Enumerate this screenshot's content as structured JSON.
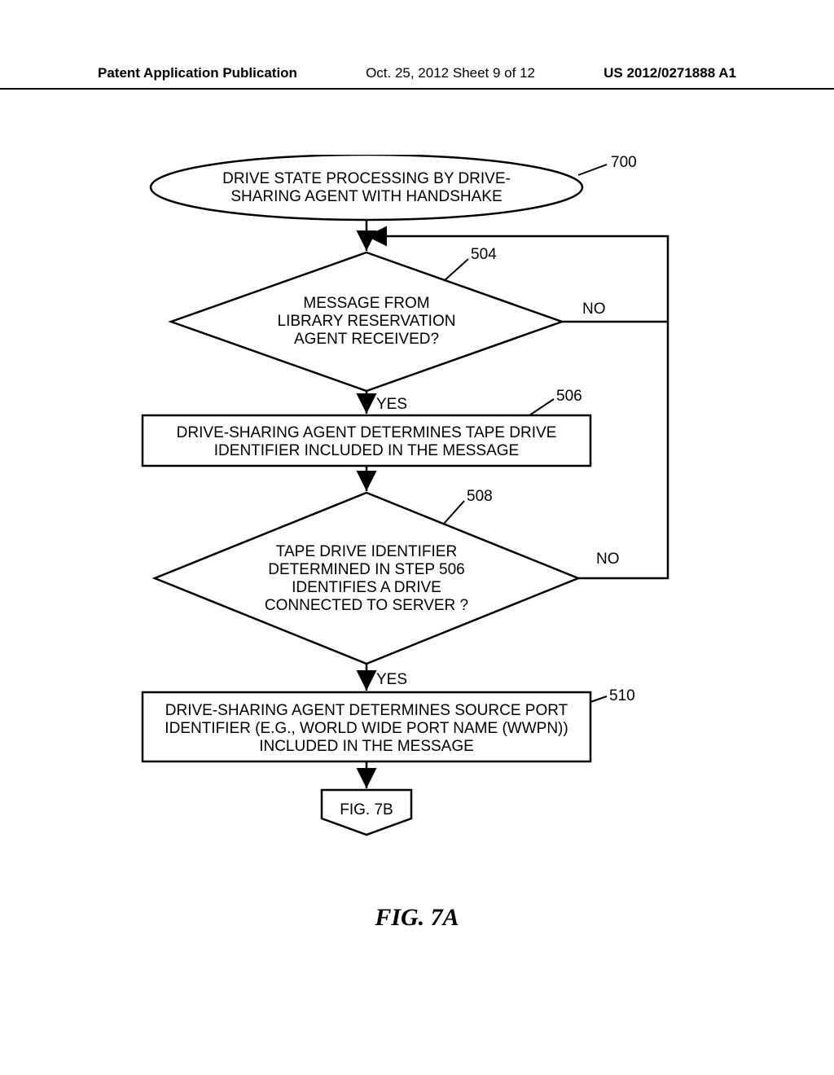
{
  "header": {
    "left": "Patent Application Publication",
    "center": "Oct. 25, 2012  Sheet 9 of 12",
    "right": "US 2012/0271888 A1"
  },
  "flowchart": {
    "terminal": {
      "line1": "DRIVE STATE PROCESSING BY DRIVE-",
      "line2": "SHARING AGENT WITH HANDSHAKE",
      "ref": "700"
    },
    "decision1": {
      "line1": "MESSAGE FROM",
      "line2": "LIBRARY RESERVATION",
      "line3": "AGENT RECEIVED?",
      "ref": "504",
      "yes": "YES",
      "no": "NO"
    },
    "process1": {
      "line1": "DRIVE-SHARING AGENT DETERMINES TAPE DRIVE",
      "line2": "IDENTIFIER INCLUDED IN THE MESSAGE",
      "ref": "506"
    },
    "decision2": {
      "line1": "TAPE DRIVE IDENTIFIER",
      "line2": "DETERMINED IN STEP 506",
      "line3": "IDENTIFIES A DRIVE",
      "line4": "CONNECTED TO SERVER ?",
      "ref": "508",
      "yes": "YES",
      "no": "NO"
    },
    "process2": {
      "line1": "DRIVE-SHARING AGENT DETERMINES SOURCE PORT",
      "line2": "IDENTIFIER (E.G., WORLD WIDE PORT NAME (WWPN))",
      "line3": "INCLUDED IN THE MESSAGE",
      "ref": "510"
    },
    "connector": {
      "text": "FIG. 7B"
    }
  },
  "caption": "FIG. 7A"
}
